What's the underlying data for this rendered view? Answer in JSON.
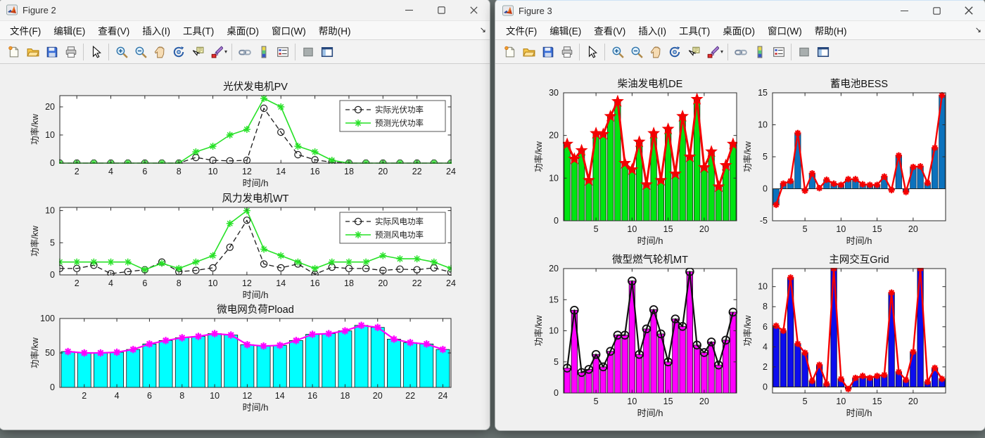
{
  "fig2": {
    "title": "Figure 2"
  },
  "fig3": {
    "title": "Figure 3"
  },
  "menu": {
    "items": [
      "文件(F)",
      "编辑(E)",
      "查看(V)",
      "插入(I)",
      "工具(T)",
      "桌面(D)",
      "窗口(W)",
      "帮助(H)"
    ],
    "overflow_arrow": "↘"
  },
  "window_controls": {
    "minimize": "minimize",
    "maximize": "maximize",
    "close": "close"
  },
  "toolbar": {
    "groups": [
      [
        "new-figure",
        "open-file",
        "save-figure",
        "print-figure"
      ],
      [
        "pointer"
      ],
      [
        "zoom-in",
        "zoom-out",
        "pan",
        "rotate-3d",
        "data-cursor",
        "brush-data"
      ],
      [
        "link-plot",
        "insert-colorbar",
        "insert-legend"
      ],
      [
        "hide-plot-tools",
        "show-plot-tools"
      ]
    ],
    "brush_caret": "▾"
  },
  "colors": {
    "green_line": "#27e127",
    "green_bar": "#00e412",
    "cyan_bar": "#00ffff",
    "magenta": "#ff00ff",
    "red": "#f40000",
    "matlab_blue": "#0c72bd",
    "pure_blue": "#0d0dee",
    "black": "#1a1a1a",
    "figure_bg": "#f0f0f0"
  },
  "chart_data": [
    {
      "id": "pv",
      "window": "Figure 2",
      "type": "line",
      "title": "光伏发电机PV",
      "xlabel": "时间/h",
      "ylabel": "功率/kw",
      "xlim": [
        1,
        24
      ],
      "ylim": [
        0,
        24
      ],
      "xticks": [
        2,
        4,
        6,
        8,
        10,
        12,
        14,
        16,
        18,
        20,
        22,
        24
      ],
      "yticks": [
        0,
        10,
        20
      ],
      "legend": [
        "实际光伏功率",
        "预测光伏功率"
      ],
      "legend_position": "top-right",
      "series": [
        {
          "name": "实际光伏功率",
          "color": "#1a1a1a",
          "dash": true,
          "marker": "circle",
          "msize": 4.6,
          "mlw": 1.2,
          "lw": 1.3,
          "values": [
            0,
            0,
            0,
            0,
            0,
            0,
            0,
            0,
            2,
            1,
            0.8,
            1,
            19.5,
            11,
            3,
            1.2,
            0.3,
            0,
            0,
            0,
            0,
            0,
            0,
            0
          ]
        },
        {
          "name": "预测光伏功率",
          "color": "#27e127",
          "dash": false,
          "marker": "asterisk",
          "msize": 5,
          "mlw": 1.5,
          "lw": 1.6,
          "values": [
            0,
            0,
            0,
            0,
            0,
            0,
            0,
            0,
            4,
            6,
            10,
            12,
            23,
            20,
            6,
            4,
            1,
            0,
            0,
            0,
            0,
            0,
            0,
            0
          ]
        }
      ]
    },
    {
      "id": "wt",
      "window": "Figure 2",
      "type": "line",
      "title": "风力发电机WT",
      "xlabel": "时间/h",
      "ylabel": "功率/kw",
      "xlim": [
        1,
        24
      ],
      "ylim": [
        0,
        10.5
      ],
      "xticks": [
        2,
        4,
        6,
        8,
        10,
        12,
        14,
        16,
        18,
        20,
        22,
        24
      ],
      "yticks": [
        0,
        5,
        10
      ],
      "legend": [
        "实际风电功率",
        "预测风电功率"
      ],
      "legend_position": "top-right",
      "series": [
        {
          "name": "实际风电功率",
          "color": "#1a1a1a",
          "dash": true,
          "marker": "circle",
          "msize": 4.6,
          "mlw": 1.2,
          "lw": 1.3,
          "values": [
            1,
            1,
            1.5,
            0.2,
            0.5,
            0.8,
            2,
            0.5,
            0.7,
            1.1,
            4.3,
            8.5,
            1.7,
            1.1,
            1.7,
            0.1,
            1.2,
            1,
            1,
            0.7,
            0.9,
            0.8,
            1.1,
            0.4
          ]
        },
        {
          "name": "预测风电功率",
          "color": "#27e127",
          "dash": false,
          "marker": "asterisk",
          "msize": 5,
          "mlw": 1.5,
          "lw": 1.6,
          "values": [
            2,
            2,
            2,
            2,
            2,
            0.8,
            1.8,
            1,
            2,
            3,
            8,
            10,
            4,
            3,
            2,
            1,
            2,
            2,
            2,
            3,
            2.5,
            2.5,
            2,
            1
          ]
        }
      ]
    },
    {
      "id": "pload",
      "window": "Figure 2",
      "type": "bar-line",
      "title": "微电网负荷Pload",
      "xlabel": "时间/h",
      "ylabel": "功率/kw",
      "xlim": [
        0.5,
        24.5
      ],
      "ylim": [
        0,
        100
      ],
      "xticks": [
        2,
        4,
        6,
        8,
        10,
        12,
        14,
        16,
        18,
        20,
        22,
        24
      ],
      "yticks": [
        0,
        50,
        100
      ],
      "bar": {
        "color": "#00ffff",
        "edge": "#111111"
      },
      "line": {
        "color": "#ff00ff",
        "marker": "asterisk",
        "msize": 5.2,
        "mlw": 2.2,
        "lw": 2.2
      },
      "values": [
        52,
        50,
        50,
        51,
        55,
        63,
        68,
        72,
        74,
        78,
        76,
        62,
        60,
        61,
        68,
        77,
        78,
        82,
        90,
        87,
        70,
        65,
        63,
        55
      ]
    },
    {
      "id": "de",
      "window": "Figure 3",
      "type": "bar-line",
      "title": "柴油发电机DE",
      "xlabel": "时间/h",
      "ylabel": "功率/kw",
      "xlim": [
        0.5,
        24.5
      ],
      "ylim": [
        0,
        30
      ],
      "xticks": [
        5,
        10,
        15,
        20
      ],
      "yticks": [
        0,
        10,
        20,
        30
      ],
      "bar": {
        "color": "#00e412",
        "edge": "#0c300c"
      },
      "line": {
        "color": "#f40000",
        "marker": "star",
        "msize": 8,
        "mlw": 1,
        "lw": 3
      },
      "values": [
        18,
        14.5,
        16.5,
        9.5,
        20.5,
        20.3,
        24.5,
        28,
        13.5,
        12,
        18.5,
        8.5,
        20.5,
        9.5,
        21.5,
        11,
        24.5,
        15,
        28.5,
        12.5,
        16.2,
        8,
        13,
        18
      ]
    },
    {
      "id": "bess",
      "window": "Figure 3",
      "type": "bar-line",
      "title": "蓄电池BESS",
      "xlabel": "时间/h",
      "ylabel": "功率/kw",
      "xlim": [
        0.5,
        24.5
      ],
      "ylim": [
        -5,
        15
      ],
      "xticks": [
        5,
        10,
        15,
        20
      ],
      "yticks": [
        -5,
        0,
        5,
        10,
        15
      ],
      "bar": {
        "color": "#0c72bd",
        "edge": "#0a3a62"
      },
      "line": {
        "color": "#f40000",
        "marker": "asterisk",
        "msize": 4.6,
        "mlw": 2.2,
        "lw": 2.4
      },
      "values": [
        -2.5,
        0.8,
        1.2,
        8.7,
        -0.3,
        2.4,
        0.1,
        1.4,
        0.8,
        0.6,
        1.5,
        1.5,
        0.7,
        0.6,
        0.6,
        1.9,
        -0.2,
        5.2,
        -0.5,
        3.4,
        3.5,
        0.9,
        6.4,
        14.6
      ]
    },
    {
      "id": "mt",
      "window": "Figure 3",
      "type": "bar-line",
      "title": "微型燃气轮机MT",
      "xlabel": "时间/h",
      "ylabel": "功率/kw",
      "xlim": [
        0.5,
        24.5
      ],
      "ylim": [
        0,
        20
      ],
      "xticks": [
        5,
        10,
        15,
        20
      ],
      "yticks": [
        0,
        5,
        10,
        15,
        20
      ],
      "bar": {
        "color": "#ff00ff",
        "edge": "#1a051a"
      },
      "line": {
        "color": "#111111",
        "marker": "circle",
        "msize": 5.4,
        "mlw": 1.8,
        "lw": 2.2
      },
      "values": [
        4,
        13.3,
        3.3,
        3.8,
        6.2,
        4.2,
        6.7,
        9.3,
        9.3,
        18,
        6.2,
        10.3,
        13.4,
        9.5,
        5,
        11.9,
        10.7,
        19.5,
        7.7,
        6.5,
        8.2,
        4.5,
        8.5,
        13
      ]
    },
    {
      "id": "grid",
      "window": "Figure 3",
      "type": "bar-line",
      "title": "主网交互Grid",
      "xlabel": "时间/h",
      "ylabel": "功率/kw",
      "xlim": [
        0.5,
        24.5
      ],
      "ylim": [
        -0.6,
        11.8
      ],
      "xticks": [
        5,
        10,
        15,
        20
      ],
      "yticks": [
        0,
        2,
        4,
        6,
        8,
        10
      ],
      "bar": {
        "color": "#0d0dee",
        "edge": "#05053a"
      },
      "line": {
        "color": "#f40000",
        "marker": "asterisk",
        "msize": 4.6,
        "mlw": 2.2,
        "lw": 2.4
      },
      "values": [
        6.1,
        5.6,
        10.9,
        4.3,
        3.4,
        0.6,
        2.2,
        0.3,
        11.8,
        0.8,
        -0.2,
        0.9,
        1.1,
        0.9,
        1.1,
        1.2,
        9.4,
        1.5,
        0.7,
        3.5,
        11.8,
        0.5,
        1.9,
        0.8
      ]
    }
  ]
}
